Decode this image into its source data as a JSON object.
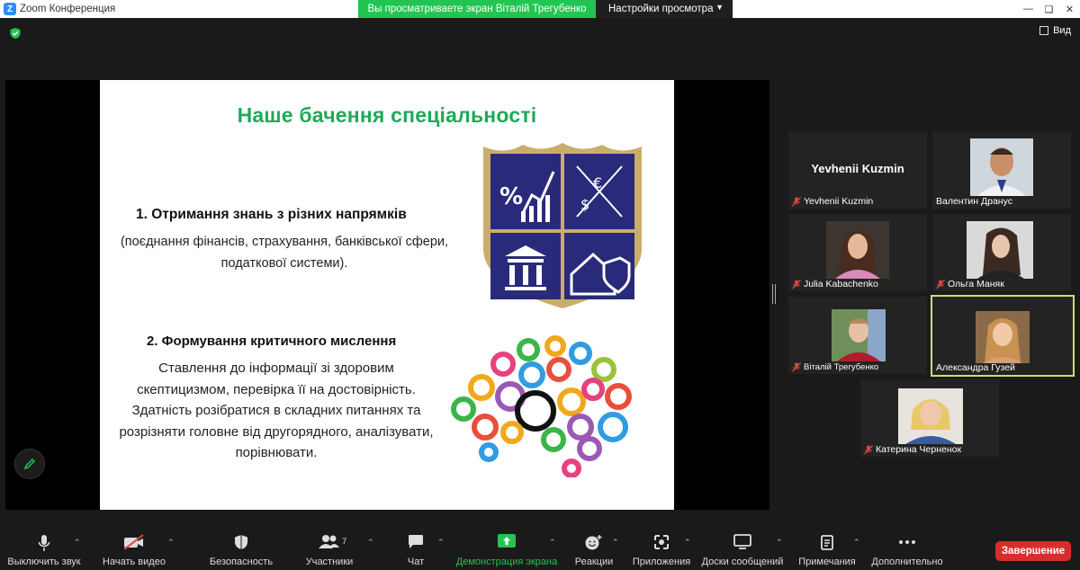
{
  "window": {
    "title": "Zoom Конференция",
    "logo_letter": "Z"
  },
  "share_banner": {
    "text": "Вы просматриваете экран Віталій Трегубенко"
  },
  "view_settings": {
    "label": "Настройки просмотра"
  },
  "view_button": {
    "label": "Вид"
  },
  "slide": {
    "title": "Наше бачення спеціальності",
    "point1_heading": "1.   Отримання знань з різних напрямків",
    "point1_body": "(поєднання фінансів, страхування, банківської сфери, податкової системи).",
    "point2_heading": "2. Формування критичного мислення",
    "point2_body": "Ставлення до інформації зі здоровим скептицизмом, перевірка її на достовірність. Здатність розібратися в складних питаннях та розрізняти головне від другорядного, аналізувати, порівнювати.",
    "emblem_symbols": {
      "percent": "%",
      "euro": "€",
      "dollar": "$"
    }
  },
  "participants": [
    {
      "name": "Yevhenii Kuzmin",
      "big_name": "Yevhenii Kuzmin",
      "muted": true,
      "video": false
    },
    {
      "name": "Валентин Дранус",
      "muted": false,
      "video": true
    },
    {
      "name": "Julia Kabachenko",
      "muted": true,
      "video": true
    },
    {
      "name": "Ольга Маняк",
      "muted": true,
      "video": true
    },
    {
      "name": "Віталій Трегубенко",
      "muted": true,
      "video": true
    },
    {
      "name": "Александра Гузей",
      "muted": false,
      "video": true,
      "active_speaker": true
    },
    {
      "name": "Катерина Черненок",
      "muted": true,
      "video": true
    }
  ],
  "toolbar": {
    "mute": "Выключить звук",
    "video": "Начать видео",
    "security": "Безопасность",
    "participants": "Участники",
    "participants_count": "7",
    "chat": "Чат",
    "share": "Демонстрация экрана",
    "reactions": "Реакции",
    "apps": "Приложения",
    "whiteboards": "Доски сообщений",
    "notes": "Примечания",
    "more": "Дополнительно",
    "end": "Завершение"
  },
  "colors": {
    "accent_green": "#23c552",
    "slide_title": "#1faa59",
    "end_red": "#d92d2d",
    "active_border": "#c7e26a",
    "emblem_blue": "#2a2a7a",
    "emblem_gold": "#c9ad6a"
  }
}
